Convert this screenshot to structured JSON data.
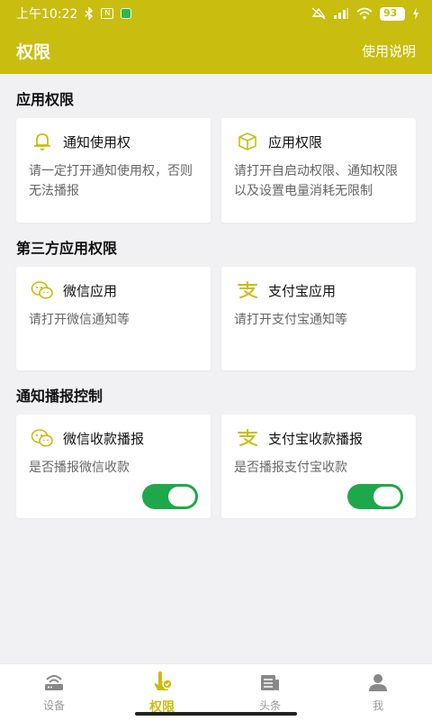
{
  "status_bar": {
    "time": "上午10:22",
    "battery": "93",
    "colors": {
      "bar": "#c9bd0f"
    }
  },
  "header": {
    "title": "权限",
    "help_label": "使用说明"
  },
  "sections": [
    {
      "title": "应用权限",
      "cards": [
        {
          "icon": "bell-icon",
          "title": "通知使用权",
          "desc": "请一定打开通知使用权，否则无法播报"
        },
        {
          "icon": "cube-icon",
          "title": "应用权限",
          "desc": "请打开自启动权限、通知权限以及设置电量消耗无限制"
        }
      ]
    },
    {
      "title": "第三方应用权限",
      "cards": [
        {
          "icon": "wechat-icon",
          "title": "微信应用",
          "desc": "请打开微信通知等"
        },
        {
          "icon": "alipay-icon",
          "title": "支付宝应用",
          "desc": "请打开支付宝通知等"
        }
      ]
    },
    {
      "title": "通知播报控制",
      "cards": [
        {
          "icon": "wechat-icon",
          "title": "微信收款播报",
          "desc": "是否播报微信收款",
          "toggle_on": true
        },
        {
          "icon": "alipay-icon",
          "title": "支付宝收款播报",
          "desc": "是否播报支付宝收款",
          "toggle_on": true
        }
      ]
    }
  ],
  "bottom_nav": [
    {
      "icon": "router-icon",
      "label": "设备"
    },
    {
      "icon": "shield-hand-icon",
      "label": "权限",
      "active": true
    },
    {
      "icon": "news-icon",
      "label": "头条"
    },
    {
      "icon": "person-icon",
      "label": "我"
    }
  ],
  "accent_color": "#c9bd0f",
  "toggle_color": "#1ea84a"
}
